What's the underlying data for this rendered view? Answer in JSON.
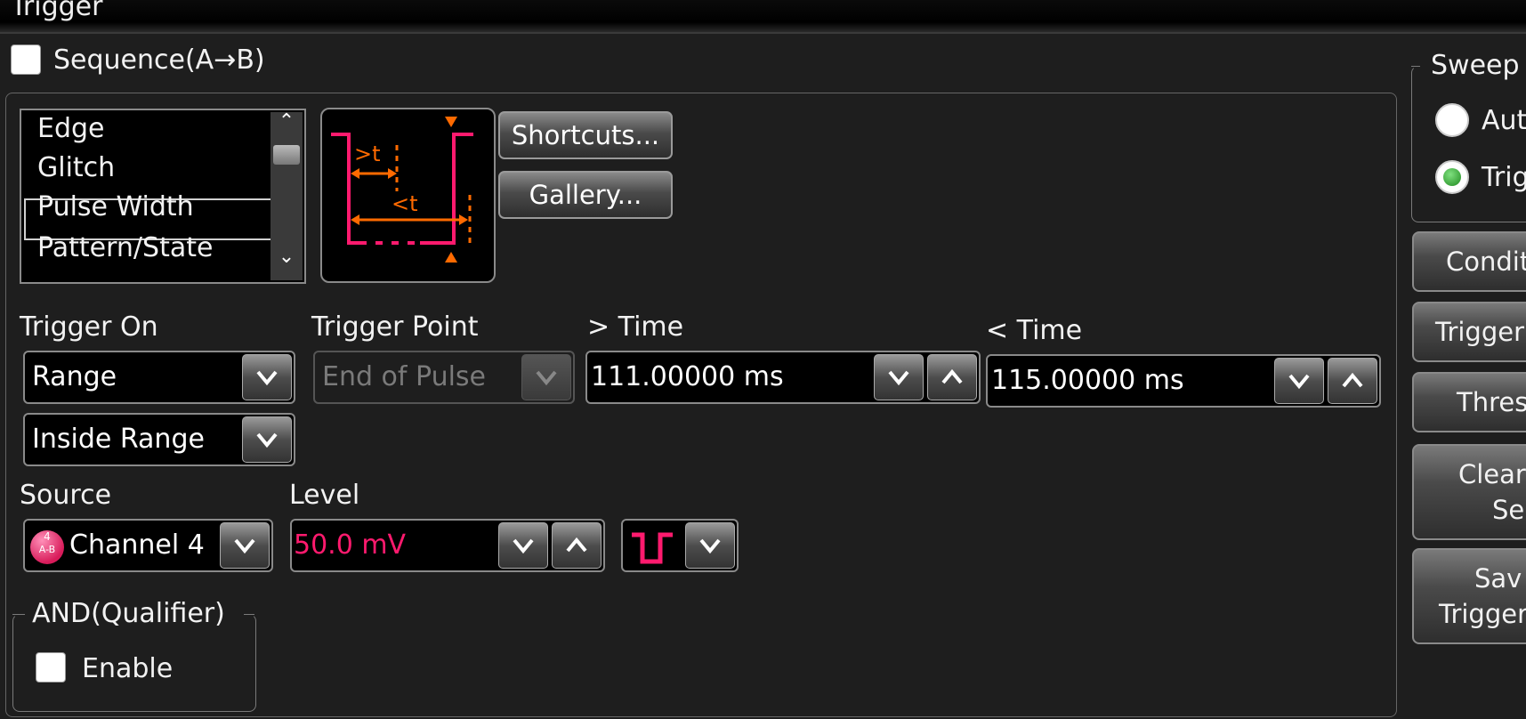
{
  "window": {
    "title": "Trigger"
  },
  "sequence": {
    "label": "Sequence(A→B)",
    "checked": false
  },
  "trigger_types": {
    "items": [
      "Edge",
      "Glitch",
      "Pulse Width",
      "Pattern/State"
    ],
    "selected": "Pulse Width"
  },
  "preview": {
    "gt_label": ">t",
    "lt_label": "<t"
  },
  "buttons": {
    "shortcuts": "Shortcuts...",
    "gallery": "Gallery..."
  },
  "trigger_on": {
    "label": "Trigger On",
    "value": "Range",
    "range_mode": "Inside Range"
  },
  "trigger_point": {
    "label": "Trigger Point",
    "value": "End of Pulse"
  },
  "gt_time": {
    "label": "> Time",
    "value": "111.00000 ms"
  },
  "lt_time": {
    "label": "< Time",
    "value": "115.00000 ms"
  },
  "source": {
    "label": "Source",
    "value": "Channel 4",
    "badge_num": "4",
    "badge_sub": "A-B"
  },
  "level": {
    "label": "Level",
    "value": "50.0 mV"
  },
  "qualifier": {
    "legend": "AND(Qualifier)",
    "enable_label": "Enable"
  },
  "sweep": {
    "legend": "Sweep",
    "options": [
      "Aut",
      "Trig"
    ],
    "selected": "Trig"
  },
  "side_buttons": {
    "conditions": "Condit",
    "trigger": "Trigger",
    "threshold": "Thres",
    "clear_line1": "Clear",
    "clear_line2": "Se",
    "save_line1": "Sav",
    "save_line2": "Trigger"
  },
  "colors": {
    "accent_pink": "#ff1a6e",
    "accent_orange": "#ff6a00",
    "background": "#1e1e1e",
    "radio_selected": "#2fa02f"
  }
}
